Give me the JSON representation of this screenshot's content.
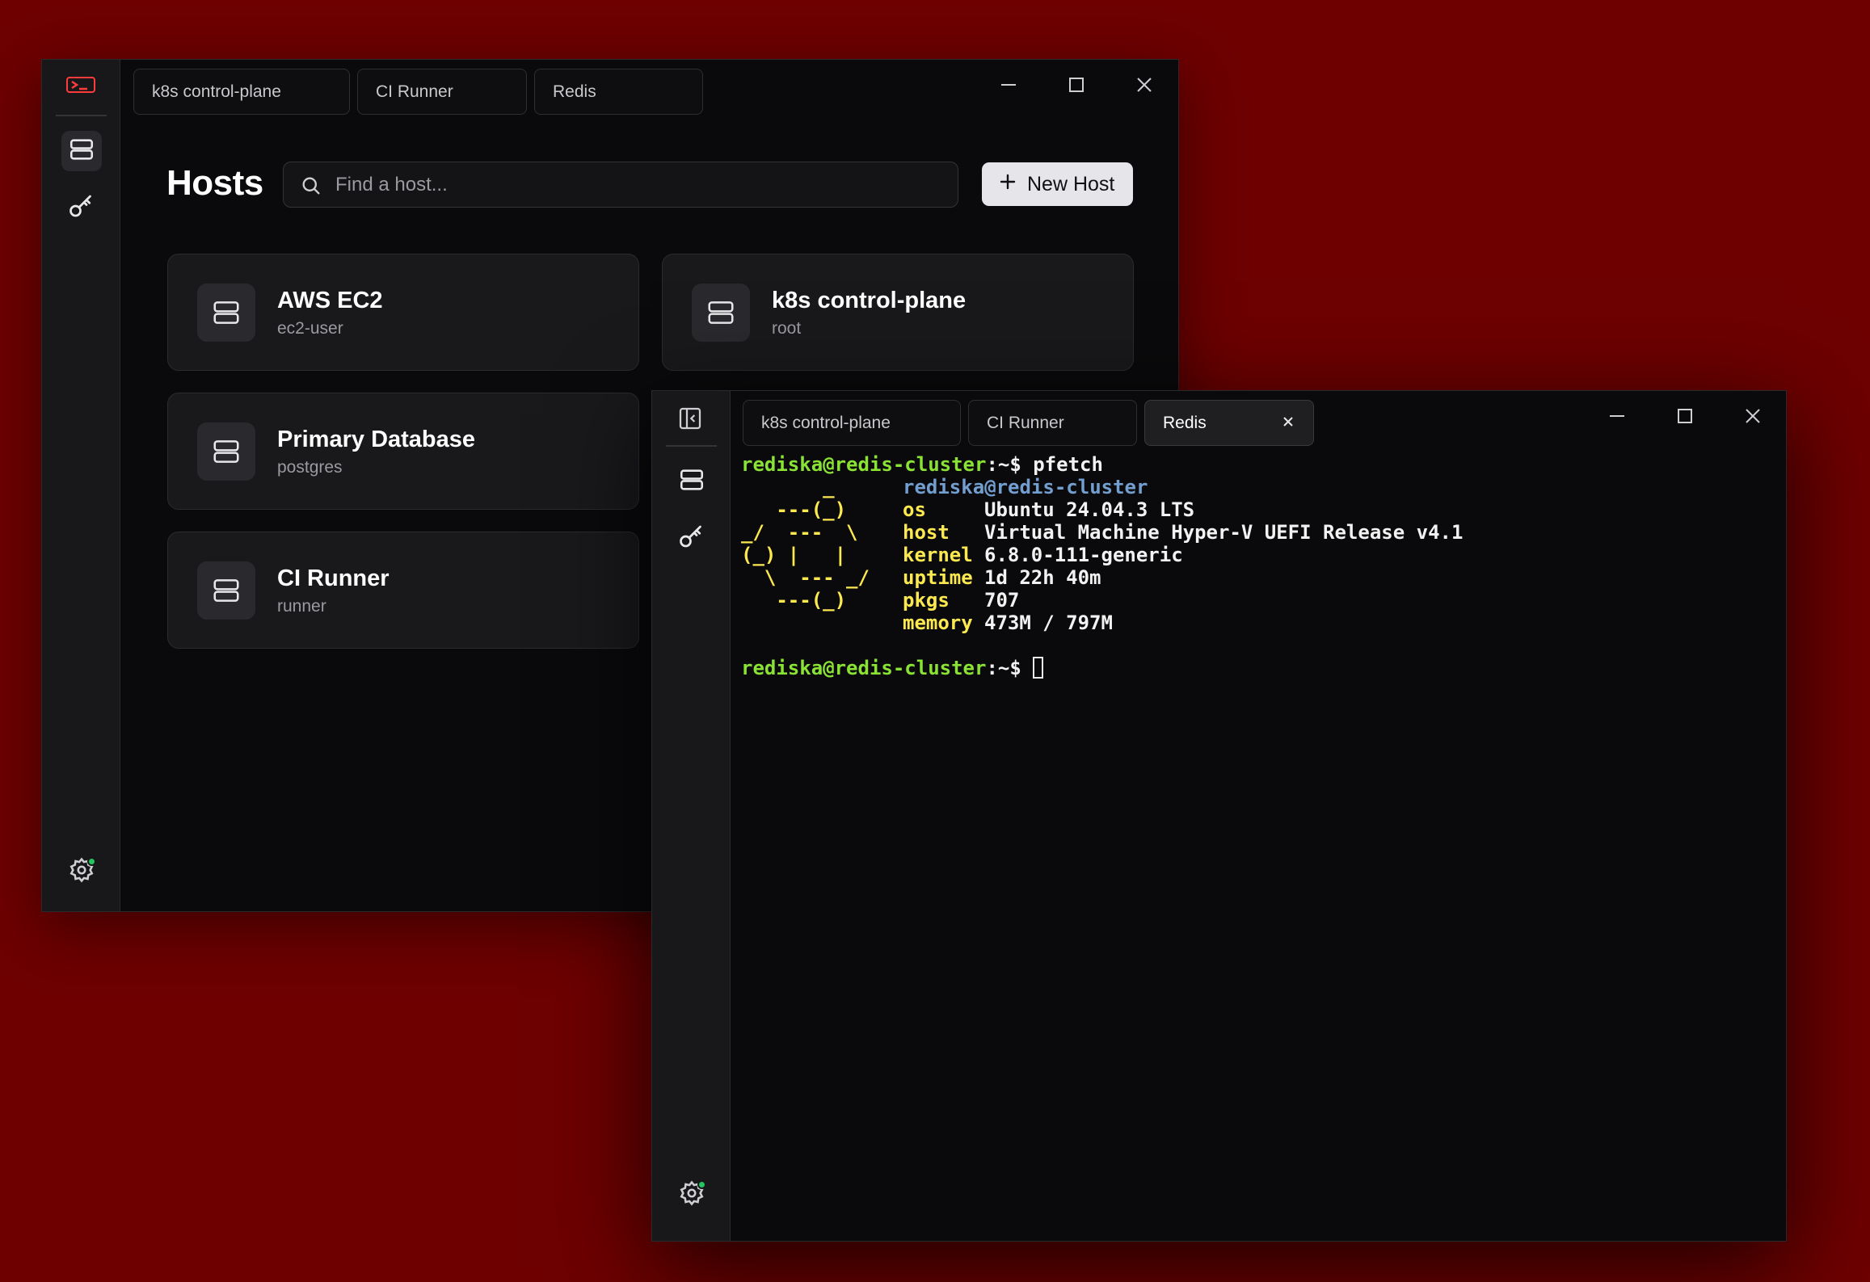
{
  "hosts_window": {
    "tabs": [
      "k8s control-plane",
      "CI Runner",
      "Redis"
    ],
    "title": "Hosts",
    "search_placeholder": "Find a host...",
    "new_host_label": "New Host",
    "hosts": [
      {
        "name": "AWS EC2",
        "user": "ec2-user"
      },
      {
        "name": "k8s control-plane",
        "user": "root"
      },
      {
        "name": "Primary Database",
        "user": "postgres"
      },
      {
        "name": "CI Runner",
        "user": "runner"
      }
    ]
  },
  "terminal_window": {
    "tabs": [
      "k8s control-plane",
      "CI Runner",
      "Redis"
    ],
    "active_tab": "Redis",
    "prompt_user": "rediska@redis-cluster",
    "prompt_suffix": ":~$ ",
    "command": "pfetch",
    "header": "rediska@redis-cluster",
    "ascii_art": [
      "       _",
      "   ---(_)",
      "_/  ---  \\",
      "(_) |   |",
      "  \\  --- _/",
      "   ---(_)"
    ],
    "info": [
      {
        "key": "os",
        "value": "Ubuntu 24.04.3 LTS"
      },
      {
        "key": "host",
        "value": "Virtual Machine Hyper-V UEFI Release v4.1"
      },
      {
        "key": "kernel",
        "value": "6.8.0-111-generic"
      },
      {
        "key": "uptime",
        "value": "1d 22h 40m"
      },
      {
        "key": "pkgs",
        "value": "707"
      },
      {
        "key": "memory",
        "value": "473M / 797M"
      }
    ]
  },
  "colors": {
    "desktop": "#6e0000",
    "window": "#0a0a0c",
    "status_dot": "#22c55e",
    "term_green": "#8ae234",
    "term_blue": "#729fcf",
    "term_yellow": "#fce94f"
  },
  "icons": [
    "app-logo-icon",
    "server-icon",
    "key-icon",
    "gear-icon",
    "search-icon",
    "plus-icon",
    "minimize-icon",
    "maximize-icon",
    "close-icon",
    "sidebar-toggle-icon"
  ]
}
